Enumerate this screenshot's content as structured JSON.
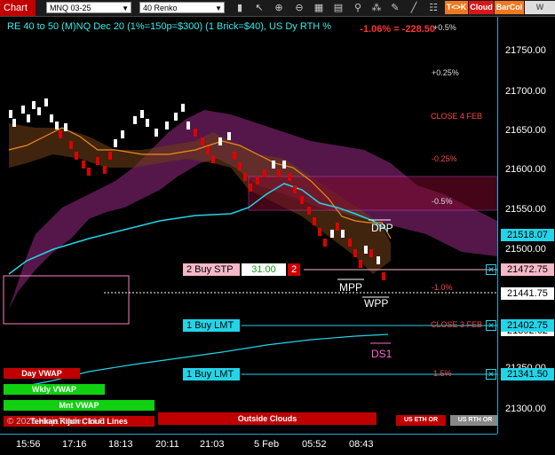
{
  "toolbar": {
    "title": "Chart",
    "instrument": "MNQ 03-25",
    "bar_type": "40 Renko",
    "icons": [
      "lock-icon",
      "pointer-icon",
      "zoom-in-icon",
      "zoom-out-icon",
      "grid-icon",
      "template-icon",
      "attach-icon",
      "indicator-icon",
      "draw-icon",
      "pen-icon",
      "settings-icon",
      "export-icon"
    ],
    "btn_tk": "T<>K",
    "btn_cloud": "Cloud",
    "btn_barcol": "BarCol",
    "btn_vwap": "W VWAP"
  },
  "chart": {
    "title": "RE 40 to 50 (M)NQ Dec 20 (1%=150p=$300) (1 Brick=$40), US Dy RTH %",
    "pnl": "-1.06% = -228.50",
    "pct_top": "+0.5%",
    "pct_025": "+0.25%",
    "close_4feb": "CLOSE 4 FEB",
    "pct_m025": "-0.25%",
    "pct_m05": "-0.5%",
    "pct_m1": "-1.0%",
    "close_3feb": "CLOSE 3 FEB",
    "pct_15": "1.5%",
    "dpp": "DPP",
    "mpp": "MPP",
    "wpp": "WPP",
    "ds1": "DS1",
    "copyright": "© 2025 NinjaTrader, LLC",
    "copyright_overlay": "Tenkan Kijun Cloud Lines"
  },
  "orders": {
    "stp_label": "2 Buy STP",
    "stp_price": "31.00",
    "stp_qty": "2",
    "lmt1_label": "1 Buy LMT",
    "lmt2_label": "1 Buy LMT"
  },
  "status_bars": {
    "day_vwap": "Day VWAP",
    "wkly_vwap": "Wkly VWAP",
    "mnt_vwap": "Mnt VWAP",
    "outside_clouds": "Outside Clouds",
    "us_eth": "US ETH OR",
    "us_rth": "US RTH OR"
  },
  "price_axis": {
    "ticks": [
      "21750.00",
      "21700.00",
      "21650.00",
      "21600.00",
      "21550.00",
      "21500.00",
      "21350.00",
      "21300.00"
    ],
    "tag_cyan": "21518.07",
    "tag_stp": "21472.75",
    "tag_last": "21441.75",
    "tag_lmt1": "21402.75",
    "tag_lmt1_under": "21392.62",
    "tag_lmt2": "21341.50"
  },
  "time_axis": {
    "labels": [
      "15:56",
      "17:16",
      "18:13",
      "20:11",
      "21:03",
      "5 Feb",
      "05:52",
      "08:43"
    ]
  },
  "colors": {
    "accent_cyan": "#22d4e8",
    "bull": "#ffffff",
    "bear": "#e00000",
    "cloud_magenta": "#b0309a",
    "cloud_brown": "#5a3a1a",
    "orange": "#f08a1a"
  }
}
